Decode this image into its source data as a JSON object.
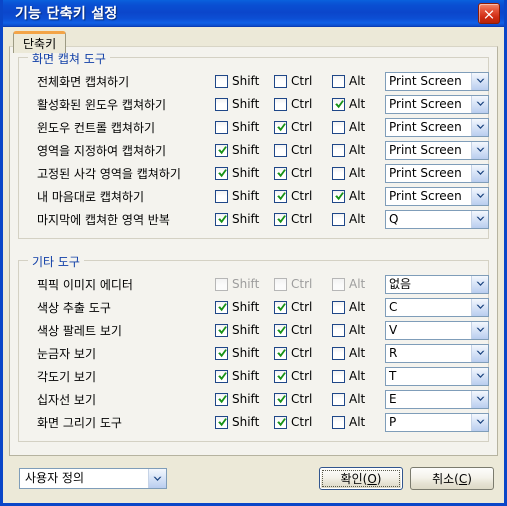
{
  "window": {
    "title": "기능 단축키 설정",
    "close_label": "닫기"
  },
  "tabs": [
    {
      "label": "단축키",
      "selected": true
    }
  ],
  "columns": {
    "shift": "Shift",
    "ctrl": "Ctrl",
    "alt": "Alt"
  },
  "groups": [
    {
      "title": "화면 캡쳐 도구",
      "rows": [
        {
          "label": "전체화면 캡쳐하기",
          "shift": false,
          "ctrl": false,
          "alt": false,
          "key": "Print Screen",
          "disabled": false
        },
        {
          "label": "활성화된 윈도우 캡쳐하기",
          "shift": false,
          "ctrl": false,
          "alt": true,
          "key": "Print Screen",
          "disabled": false
        },
        {
          "label": "윈도우 컨트롤 캡쳐하기",
          "shift": false,
          "ctrl": true,
          "alt": false,
          "key": "Print Screen",
          "disabled": false
        },
        {
          "label": "영역을 지정하여 캡쳐하기",
          "shift": true,
          "ctrl": false,
          "alt": false,
          "key": "Print Screen",
          "disabled": false
        },
        {
          "label": "고정된 사각 영역을 캡쳐하기",
          "shift": true,
          "ctrl": true,
          "alt": false,
          "key": "Print Screen",
          "disabled": false
        },
        {
          "label": "내 마음대로 캡쳐하기",
          "shift": false,
          "ctrl": true,
          "alt": true,
          "key": "Print Screen",
          "disabled": false
        },
        {
          "label": "마지막에 캡쳐한 영역 반복",
          "shift": true,
          "ctrl": true,
          "alt": false,
          "key": "Q",
          "disabled": false
        }
      ]
    },
    {
      "title": "기타 도구",
      "rows": [
        {
          "label": "픽픽 이미지 에디터",
          "shift": false,
          "ctrl": false,
          "alt": false,
          "key": "없음",
          "disabled": true
        },
        {
          "label": "색상 추출 도구",
          "shift": true,
          "ctrl": true,
          "alt": false,
          "key": "C",
          "disabled": false
        },
        {
          "label": "색상 팔레트 보기",
          "shift": true,
          "ctrl": true,
          "alt": false,
          "key": "V",
          "disabled": false
        },
        {
          "label": "눈금자 보기",
          "shift": true,
          "ctrl": true,
          "alt": false,
          "key": "R",
          "disabled": false
        },
        {
          "label": "각도기 보기",
          "shift": true,
          "ctrl": true,
          "alt": false,
          "key": "T",
          "disabled": false
        },
        {
          "label": "십자선 보기",
          "shift": true,
          "ctrl": true,
          "alt": false,
          "key": "E",
          "disabled": false
        },
        {
          "label": "화면 그리기 도구",
          "shift": true,
          "ctrl": true,
          "alt": false,
          "key": "P",
          "disabled": false
        }
      ]
    }
  ],
  "footer": {
    "preset": "사용자 정의",
    "ok_text": "확인(",
    "ok_accel": "O",
    "ok_tail": ")",
    "cancel_text": "취소(",
    "cancel_accel": "C",
    "cancel_tail": ")"
  },
  "colors": {
    "titlebar": "#0b46cb",
    "window_border": "#0a46c8",
    "panel_bg": "#f4f3ee",
    "dialog_bg": "#ece9d8",
    "group_title": "#1240a8",
    "tab_highlight": "#f3a447",
    "check_green": "#169116",
    "checkbox_border": "#1f4788",
    "close_red": "#cf2a12"
  }
}
